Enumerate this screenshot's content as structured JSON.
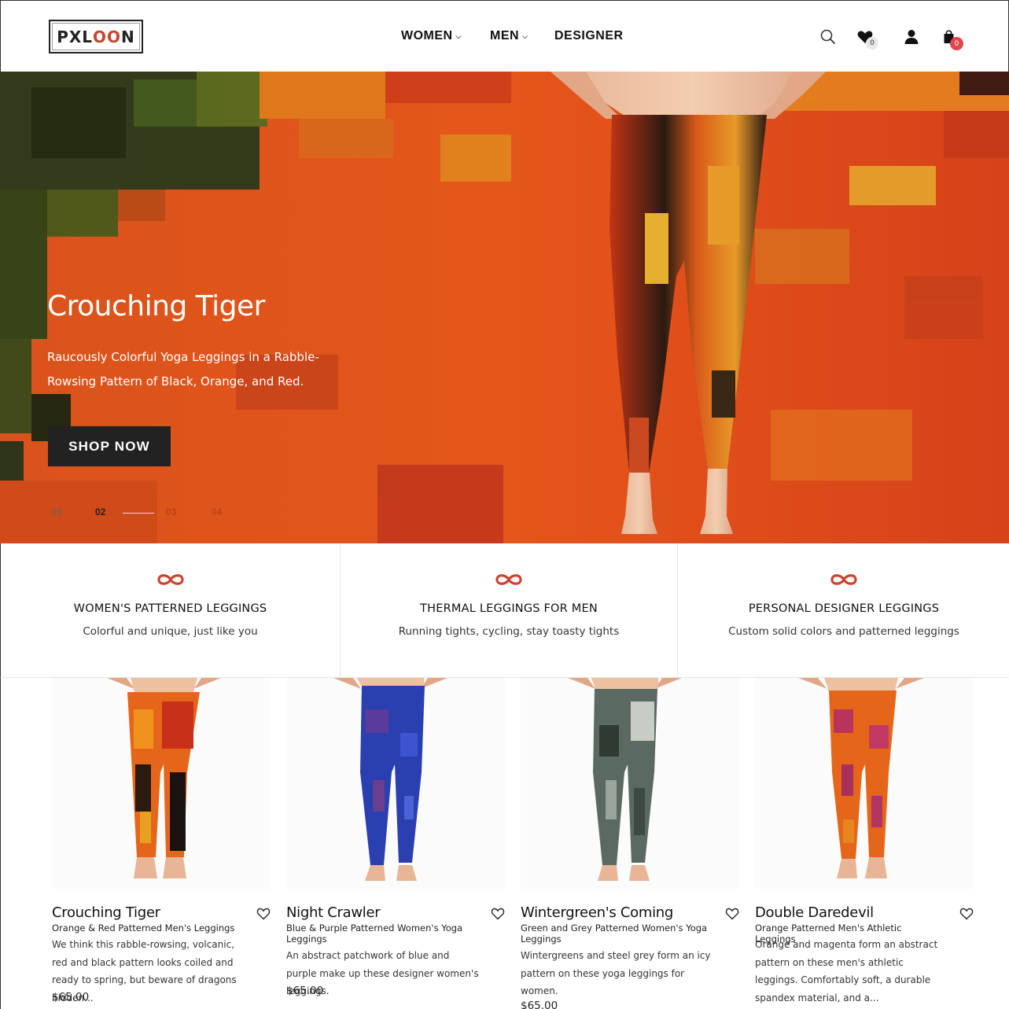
{
  "header": {
    "logo": "PXLOON",
    "logo_parts": {
      "pre": "PXL",
      "oo": "OO",
      "post": "N"
    },
    "nav": [
      {
        "label": "WOMEN",
        "has_dropdown": true
      },
      {
        "label": "MEN",
        "has_dropdown": true
      },
      {
        "label": "DESIGNER",
        "has_dropdown": false
      }
    ],
    "icons": [
      "search-icon",
      "heart-icon",
      "user-icon",
      "bag-icon"
    ],
    "wishlist_count": "0",
    "cart_count": "0"
  },
  "hero": {
    "title": "Crouching Tiger",
    "subtitle": "Raucously Colorful Yoga Leggings in a Rabble-Rowsing Pattern of Black, Orange, and Red.",
    "button": "SHOP NOW",
    "slides": [
      "01",
      "02",
      "03",
      "04"
    ],
    "active_slide": "02"
  },
  "features": [
    {
      "title": "WOMEN'S PATTERNED LEGGINGS",
      "subtitle": "Colorful and unique, just like you"
    },
    {
      "title": "THERMAL LEGGINGS FOR MEN",
      "subtitle": "Running tights, cycling, stay toasty tights"
    },
    {
      "title": "PERSONAL DESIGNER LEGGINGS",
      "subtitle": "Custom solid colors and patterned leggings"
    }
  ],
  "products": [
    {
      "name": "Crouching Tiger",
      "subtitle": "Orange & Red Patterned Men's Leggings",
      "description": "We think this rabble-rowsing, volcanic, red and black pattern looks coiled and ready to spring, but beware of dragons hidden...",
      "price": "$65.00"
    },
    {
      "name": "Night Crawler",
      "subtitle": "Blue & Purple Patterned Women's Yoga Leggings",
      "description": "An abstract patchwork of blue and purple make up these designer women's leggings.",
      "price": "$65.00"
    },
    {
      "name": "Wintergreen's Coming",
      "subtitle": "Green and Grey Patterned Women's Yoga Leggings",
      "description": "Wintergreens and steel grey form an icy pattern on these yoga leggings for women.",
      "price": "$65.00"
    },
    {
      "name": "Double Daredevil",
      "subtitle": "Orange Patterned Men's Athletic Leggings",
      "description": "Orange and magenta form an abstract pattern on these men's athletic leggings. Comfortably soft, a durable spandex material, and a...",
      "price": ""
    }
  ],
  "colors": {
    "accent": "#c9452f",
    "badge_red": "#e0474c",
    "button_dark": "#222222",
    "hero_orange": "#e2521c"
  }
}
